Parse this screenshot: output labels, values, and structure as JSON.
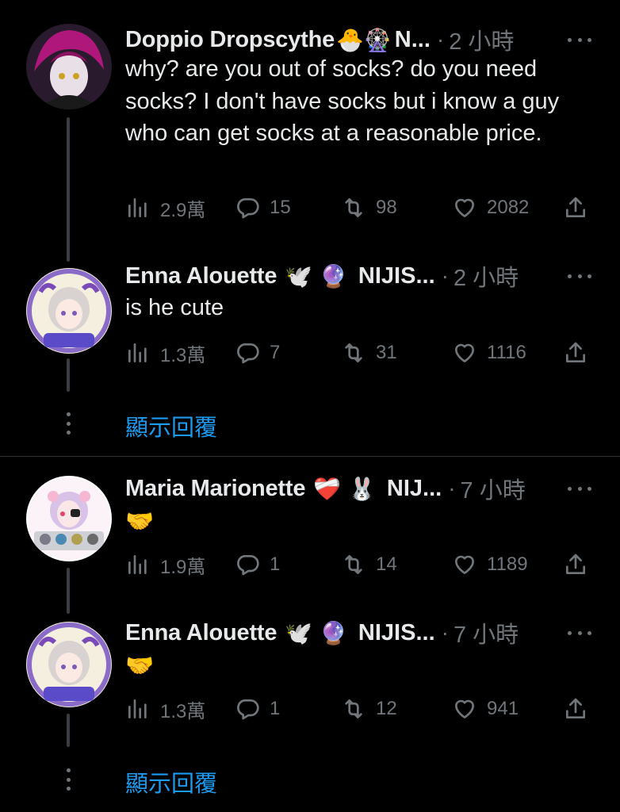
{
  "tweets": [
    {
      "name": "Doppio Dropscythe",
      "emoji": "🐣🎡",
      "affil": "N...",
      "sep": "·",
      "time": "2 小時",
      "text": "why? are you out of socks? do you need socks? I don't  have socks but i know a guy who can get socks at a reasonable price.",
      "views": "2.9萬",
      "replies": "15",
      "retweets": "98",
      "likes": "2082"
    },
    {
      "name": "Enna Alouette",
      "emoji": "🕊️ 🔮",
      "affil": "NIJIS...",
      "sep": "·",
      "time": "2 小時",
      "text": "is he cute",
      "views": "1.3萬",
      "replies": "7",
      "retweets": "31",
      "likes": "1116"
    },
    {
      "name": "Maria Marionette",
      "emoji": "❤️‍🩹 🐰",
      "affil": "NIJ...",
      "sep": "·",
      "time": "7 小時",
      "text": "🤝",
      "views": "1.9萬",
      "replies": "1",
      "retweets": "14",
      "likes": "1189"
    },
    {
      "name": "Enna Alouette",
      "emoji": "🕊️ 🔮",
      "affil": "NIJIS...",
      "sep": "·",
      "time": "7 小時",
      "text": "🤝",
      "views": "1.3萬",
      "replies": "1",
      "retweets": "12",
      "likes": "941"
    }
  ],
  "show_replies_label": "顯示回覆",
  "colors": {
    "background": "#000000",
    "text": "#e7e9ea",
    "muted": "#71767b",
    "link": "#1d9bf0",
    "divider": "#2f3336"
  },
  "icons": [
    "views-icon",
    "reply-icon",
    "retweet-icon",
    "like-icon",
    "share-icon",
    "more-icon"
  ]
}
